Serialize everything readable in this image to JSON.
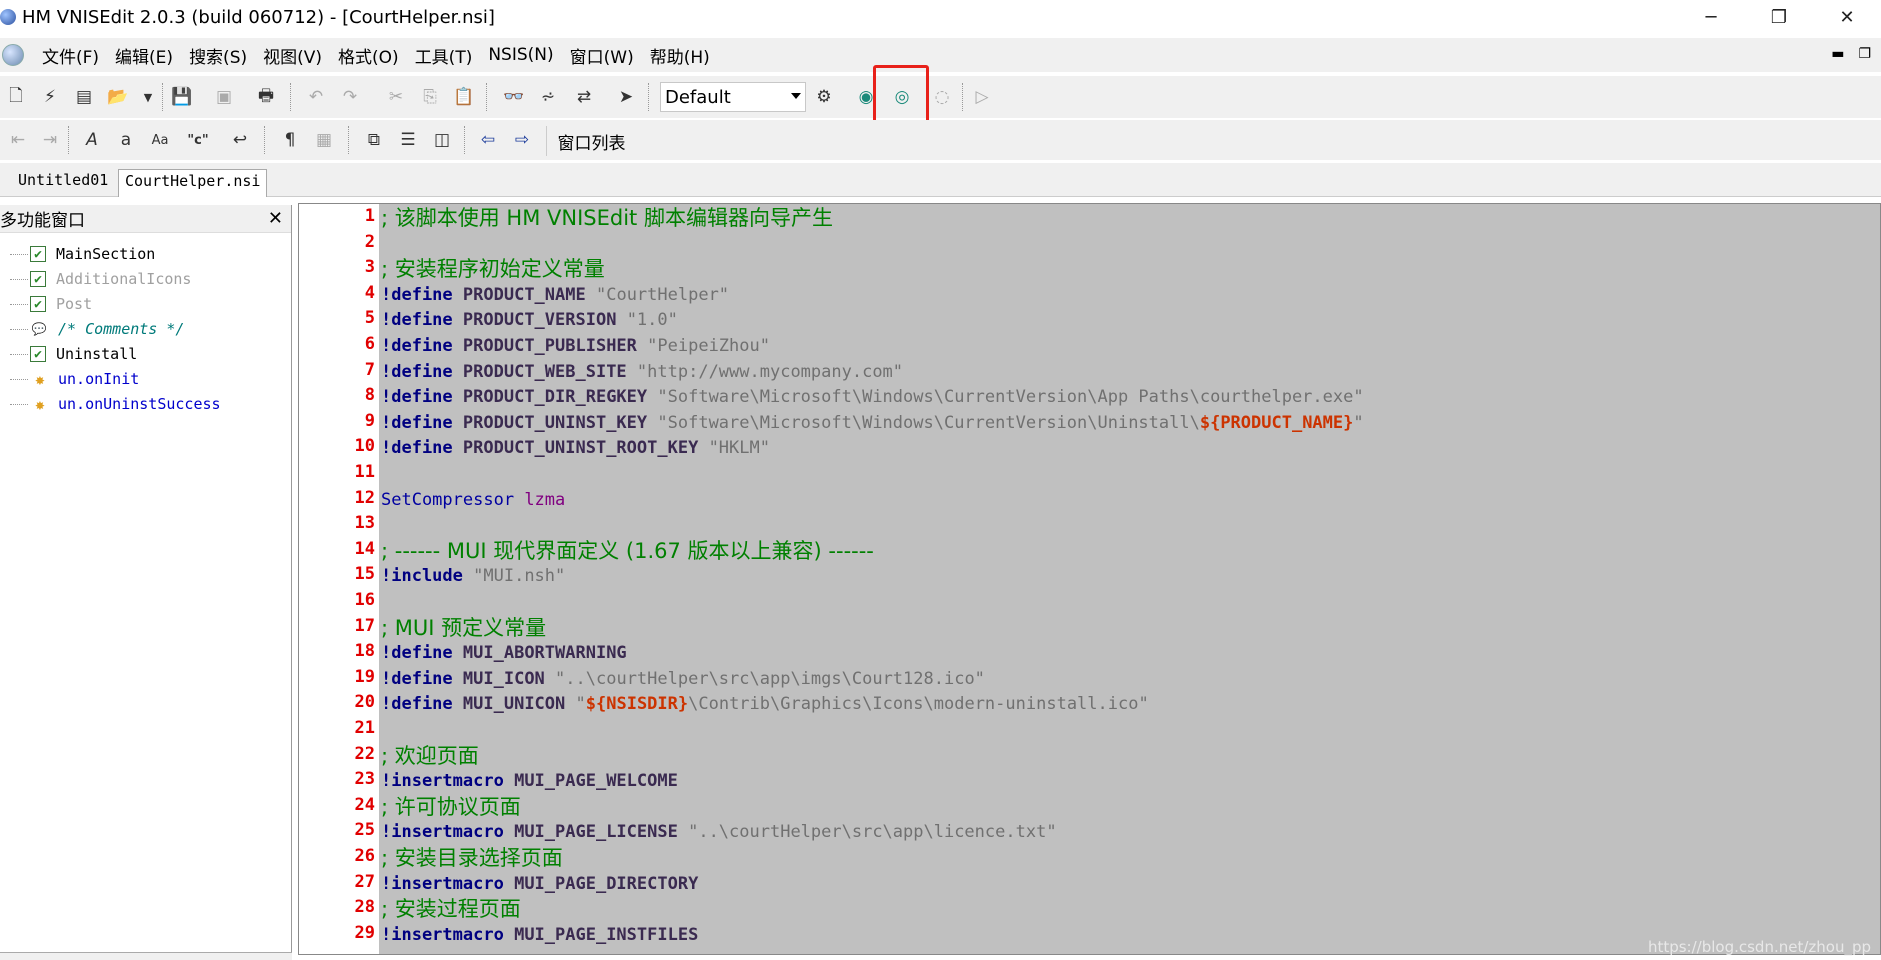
{
  "window": {
    "title": "HM VNISEdit 2.0.3 (build 060712) - [CourtHelper.nsi]",
    "minimize_glyph": "─",
    "restore_glyph": "❐",
    "close_glyph": "✕"
  },
  "menu": {
    "items": [
      "文件(F)",
      "编辑(E)",
      "搜索(S)",
      "视图(V)",
      "格式(O)",
      "工具(T)",
      "NSIS(N)",
      "窗口(W)",
      "帮助(H)"
    ],
    "mdi_minimize": "▬",
    "mdi_restore": "❐"
  },
  "toolbar": {
    "style_select_value": "Default",
    "window_list_label": "窗口列表",
    "highlight_color": "#e8211a"
  },
  "tabs": [
    {
      "label": "Untitled01"
    },
    {
      "label": "CourtHelper.nsi"
    }
  ],
  "left_panel": {
    "title": "多功能窗口",
    "close_glyph": "✕",
    "tree": [
      {
        "label": "MainSection",
        "kind": "checked",
        "color": "#000000"
      },
      {
        "label": "AdditionalIcons",
        "kind": "checked",
        "color": "#a0a0a0"
      },
      {
        "label": "Post",
        "kind": "checked",
        "color": "#a0a0a0"
      },
      {
        "label": "/* Comments */",
        "kind": "comment",
        "color": "#007a7a"
      },
      {
        "label": "Uninstall",
        "kind": "checked",
        "color": "#000000"
      },
      {
        "label": "un.onInit",
        "kind": "function",
        "color": "#0000cc"
      },
      {
        "label": "un.onUninstSuccess",
        "kind": "function",
        "color": "#0000cc"
      }
    ]
  },
  "editor": {
    "background": "#c0c0c0",
    "lines": [
      {
        "n": "1",
        "parts": [
          [
            "c-comment",
            "; 该脚本使用 HM VNISEdit 脚本编辑器向导产生"
          ]
        ]
      },
      {
        "n": "2",
        "parts": []
      },
      {
        "n": "3",
        "parts": [
          [
            "c-comment",
            "; 安装程序初始定义常量"
          ]
        ]
      },
      {
        "n": "4",
        "parts": [
          [
            "c-directive",
            "!define"
          ],
          [
            "",
            " "
          ],
          [
            "c-ident",
            "PRODUCT_NAME"
          ],
          [
            "",
            " "
          ],
          [
            "c-string",
            "\"CourtHelper\""
          ]
        ]
      },
      {
        "n": "5",
        "parts": [
          [
            "c-directive",
            "!define"
          ],
          [
            "",
            " "
          ],
          [
            "c-ident",
            "PRODUCT_VERSION"
          ],
          [
            "",
            " "
          ],
          [
            "c-string",
            "\"1.0\""
          ]
        ]
      },
      {
        "n": "6",
        "parts": [
          [
            "c-directive",
            "!define"
          ],
          [
            "",
            " "
          ],
          [
            "c-ident",
            "PRODUCT_PUBLISHER"
          ],
          [
            "",
            " "
          ],
          [
            "c-string",
            "\"PeipeiZhou\""
          ]
        ]
      },
      {
        "n": "7",
        "parts": [
          [
            "c-directive",
            "!define"
          ],
          [
            "",
            " "
          ],
          [
            "c-ident",
            "PRODUCT_WEB_SITE"
          ],
          [
            "",
            " "
          ],
          [
            "c-string",
            "\"http://www.mycompany.com\""
          ]
        ]
      },
      {
        "n": "8",
        "parts": [
          [
            "c-directive",
            "!define"
          ],
          [
            "",
            " "
          ],
          [
            "c-ident",
            "PRODUCT_DIR_REGKEY"
          ],
          [
            "",
            " "
          ],
          [
            "c-string",
            "\"Software\\Microsoft\\Windows\\CurrentVersion\\App Paths\\courthelper.exe\""
          ]
        ]
      },
      {
        "n": "9",
        "parts": [
          [
            "c-directive",
            "!define"
          ],
          [
            "",
            " "
          ],
          [
            "c-ident",
            "PRODUCT_UNINST_KEY"
          ],
          [
            "",
            " "
          ],
          [
            "c-string",
            "\"Software\\Microsoft\\Windows\\CurrentVersion\\Uninstall\\"
          ],
          [
            "c-var",
            "${PRODUCT_NAME}"
          ],
          [
            "c-string",
            "\""
          ]
        ]
      },
      {
        "n": "10",
        "parts": [
          [
            "c-directive",
            "!define"
          ],
          [
            "",
            " "
          ],
          [
            "c-ident",
            "PRODUCT_UNINST_ROOT_KEY"
          ],
          [
            "",
            " "
          ],
          [
            "c-string",
            "\"HKLM\""
          ]
        ]
      },
      {
        "n": "11",
        "parts": []
      },
      {
        "n": "12",
        "parts": [
          [
            "c-cmd",
            "SetCompressor"
          ],
          [
            "",
            " "
          ],
          [
            "c-arg",
            "lzma"
          ]
        ]
      },
      {
        "n": "13",
        "parts": []
      },
      {
        "n": "14",
        "parts": [
          [
            "c-comment",
            "; ------ MUI 现代界面定义 (1.67 版本以上兼容) ------"
          ]
        ]
      },
      {
        "n": "15",
        "parts": [
          [
            "c-directive",
            "!include"
          ],
          [
            "",
            " "
          ],
          [
            "c-string",
            "\"MUI.nsh\""
          ]
        ]
      },
      {
        "n": "16",
        "parts": []
      },
      {
        "n": "17",
        "parts": [
          [
            "c-comment",
            "; MUI 预定义常量"
          ]
        ]
      },
      {
        "n": "18",
        "parts": [
          [
            "c-directive",
            "!define"
          ],
          [
            "",
            " "
          ],
          [
            "c-ident",
            "MUI_ABORTWARNING"
          ]
        ]
      },
      {
        "n": "19",
        "parts": [
          [
            "c-directive",
            "!define"
          ],
          [
            "",
            " "
          ],
          [
            "c-ident",
            "MUI_ICON"
          ],
          [
            "",
            " "
          ],
          [
            "c-string",
            "\"..\\courtHelper\\src\\app\\imgs\\Court128.ico\""
          ]
        ]
      },
      {
        "n": "20",
        "parts": [
          [
            "c-directive",
            "!define"
          ],
          [
            "",
            " "
          ],
          [
            "c-ident",
            "MUI_UNICON"
          ],
          [
            "",
            " "
          ],
          [
            "c-string",
            "\""
          ],
          [
            "c-var",
            "${NSISDIR}"
          ],
          [
            "c-string",
            "\\Contrib\\Graphics\\Icons\\modern-uninstall.ico\""
          ]
        ]
      },
      {
        "n": "21",
        "parts": []
      },
      {
        "n": "22",
        "parts": [
          [
            "c-comment",
            "; 欢迎页面"
          ]
        ]
      },
      {
        "n": "23",
        "parts": [
          [
            "c-directive",
            "!insertmacro"
          ],
          [
            "",
            " "
          ],
          [
            "c-ident",
            "MUI_PAGE_WELCOME"
          ]
        ]
      },
      {
        "n": "24",
        "parts": [
          [
            "c-comment",
            "; 许可协议页面"
          ]
        ]
      },
      {
        "n": "25",
        "parts": [
          [
            "c-directive",
            "!insertmacro"
          ],
          [
            "",
            " "
          ],
          [
            "c-ident",
            "MUI_PAGE_LICENSE"
          ],
          [
            "",
            " "
          ],
          [
            "c-string",
            "\"..\\courtHelper\\src\\app\\licence.txt\""
          ]
        ]
      },
      {
        "n": "26",
        "parts": [
          [
            "c-comment",
            "; 安装目录选择页面"
          ]
        ]
      },
      {
        "n": "27",
        "parts": [
          [
            "c-directive",
            "!insertmacro"
          ],
          [
            "",
            " "
          ],
          [
            "c-ident",
            "MUI_PAGE_DIRECTORY"
          ]
        ]
      },
      {
        "n": "28",
        "parts": [
          [
            "c-comment",
            "; 安装过程页面"
          ]
        ]
      },
      {
        "n": "29",
        "parts": [
          [
            "c-directive",
            "!insertmacro"
          ],
          [
            "",
            " "
          ],
          [
            "c-ident",
            "MUI_PAGE_INSTFILES"
          ]
        ]
      }
    ]
  },
  "watermark": "https://blog.csdn.net/zhou_pp"
}
